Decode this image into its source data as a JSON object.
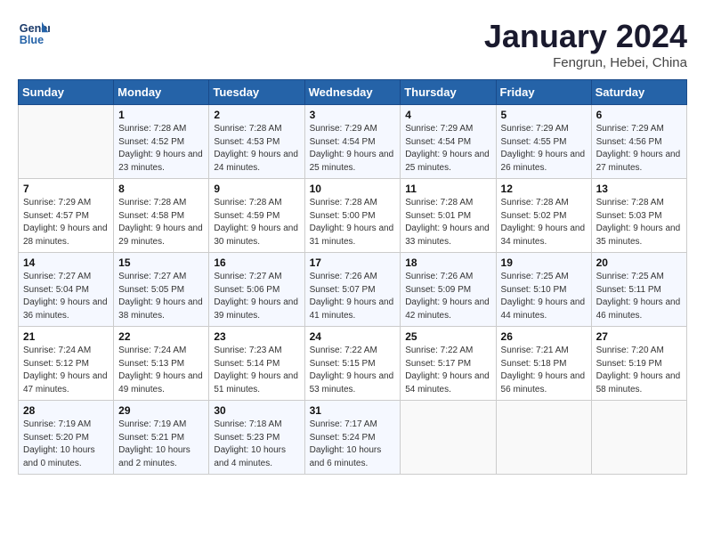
{
  "header": {
    "logo_line1": "General",
    "logo_line2": "Blue",
    "month": "January 2024",
    "location": "Fengrun, Hebei, China"
  },
  "weekdays": [
    "Sunday",
    "Monday",
    "Tuesday",
    "Wednesday",
    "Thursday",
    "Friday",
    "Saturday"
  ],
  "weeks": [
    [
      {
        "day": "",
        "sunrise": "",
        "sunset": "",
        "daylight": ""
      },
      {
        "day": "1",
        "sunrise": "7:28 AM",
        "sunset": "4:52 PM",
        "daylight": "9 hours and 23 minutes."
      },
      {
        "day": "2",
        "sunrise": "7:28 AM",
        "sunset": "4:53 PM",
        "daylight": "9 hours and 24 minutes."
      },
      {
        "day": "3",
        "sunrise": "7:29 AM",
        "sunset": "4:54 PM",
        "daylight": "9 hours and 25 minutes."
      },
      {
        "day": "4",
        "sunrise": "7:29 AM",
        "sunset": "4:54 PM",
        "daylight": "9 hours and 25 minutes."
      },
      {
        "day": "5",
        "sunrise": "7:29 AM",
        "sunset": "4:55 PM",
        "daylight": "9 hours and 26 minutes."
      },
      {
        "day": "6",
        "sunrise": "7:29 AM",
        "sunset": "4:56 PM",
        "daylight": "9 hours and 27 minutes."
      }
    ],
    [
      {
        "day": "7",
        "sunrise": "7:29 AM",
        "sunset": "4:57 PM",
        "daylight": "9 hours and 28 minutes."
      },
      {
        "day": "8",
        "sunrise": "7:28 AM",
        "sunset": "4:58 PM",
        "daylight": "9 hours and 29 minutes."
      },
      {
        "day": "9",
        "sunrise": "7:28 AM",
        "sunset": "4:59 PM",
        "daylight": "9 hours and 30 minutes."
      },
      {
        "day": "10",
        "sunrise": "7:28 AM",
        "sunset": "5:00 PM",
        "daylight": "9 hours and 31 minutes."
      },
      {
        "day": "11",
        "sunrise": "7:28 AM",
        "sunset": "5:01 PM",
        "daylight": "9 hours and 33 minutes."
      },
      {
        "day": "12",
        "sunrise": "7:28 AM",
        "sunset": "5:02 PM",
        "daylight": "9 hours and 34 minutes."
      },
      {
        "day": "13",
        "sunrise": "7:28 AM",
        "sunset": "5:03 PM",
        "daylight": "9 hours and 35 minutes."
      }
    ],
    [
      {
        "day": "14",
        "sunrise": "7:27 AM",
        "sunset": "5:04 PM",
        "daylight": "9 hours and 36 minutes."
      },
      {
        "day": "15",
        "sunrise": "7:27 AM",
        "sunset": "5:05 PM",
        "daylight": "9 hours and 38 minutes."
      },
      {
        "day": "16",
        "sunrise": "7:27 AM",
        "sunset": "5:06 PM",
        "daylight": "9 hours and 39 minutes."
      },
      {
        "day": "17",
        "sunrise": "7:26 AM",
        "sunset": "5:07 PM",
        "daylight": "9 hours and 41 minutes."
      },
      {
        "day": "18",
        "sunrise": "7:26 AM",
        "sunset": "5:09 PM",
        "daylight": "9 hours and 42 minutes."
      },
      {
        "day": "19",
        "sunrise": "7:25 AM",
        "sunset": "5:10 PM",
        "daylight": "9 hours and 44 minutes."
      },
      {
        "day": "20",
        "sunrise": "7:25 AM",
        "sunset": "5:11 PM",
        "daylight": "9 hours and 46 minutes."
      }
    ],
    [
      {
        "day": "21",
        "sunrise": "7:24 AM",
        "sunset": "5:12 PM",
        "daylight": "9 hours and 47 minutes."
      },
      {
        "day": "22",
        "sunrise": "7:24 AM",
        "sunset": "5:13 PM",
        "daylight": "9 hours and 49 minutes."
      },
      {
        "day": "23",
        "sunrise": "7:23 AM",
        "sunset": "5:14 PM",
        "daylight": "9 hours and 51 minutes."
      },
      {
        "day": "24",
        "sunrise": "7:22 AM",
        "sunset": "5:15 PM",
        "daylight": "9 hours and 53 minutes."
      },
      {
        "day": "25",
        "sunrise": "7:22 AM",
        "sunset": "5:17 PM",
        "daylight": "9 hours and 54 minutes."
      },
      {
        "day": "26",
        "sunrise": "7:21 AM",
        "sunset": "5:18 PM",
        "daylight": "9 hours and 56 minutes."
      },
      {
        "day": "27",
        "sunrise": "7:20 AM",
        "sunset": "5:19 PM",
        "daylight": "9 hours and 58 minutes."
      }
    ],
    [
      {
        "day": "28",
        "sunrise": "7:19 AM",
        "sunset": "5:20 PM",
        "daylight": "10 hours and 0 minutes."
      },
      {
        "day": "29",
        "sunrise": "7:19 AM",
        "sunset": "5:21 PM",
        "daylight": "10 hours and 2 minutes."
      },
      {
        "day": "30",
        "sunrise": "7:18 AM",
        "sunset": "5:23 PM",
        "daylight": "10 hours and 4 minutes."
      },
      {
        "day": "31",
        "sunrise": "7:17 AM",
        "sunset": "5:24 PM",
        "daylight": "10 hours and 6 minutes."
      },
      {
        "day": "",
        "sunrise": "",
        "sunset": "",
        "daylight": ""
      },
      {
        "day": "",
        "sunrise": "",
        "sunset": "",
        "daylight": ""
      },
      {
        "day": "",
        "sunrise": "",
        "sunset": "",
        "daylight": ""
      }
    ]
  ]
}
